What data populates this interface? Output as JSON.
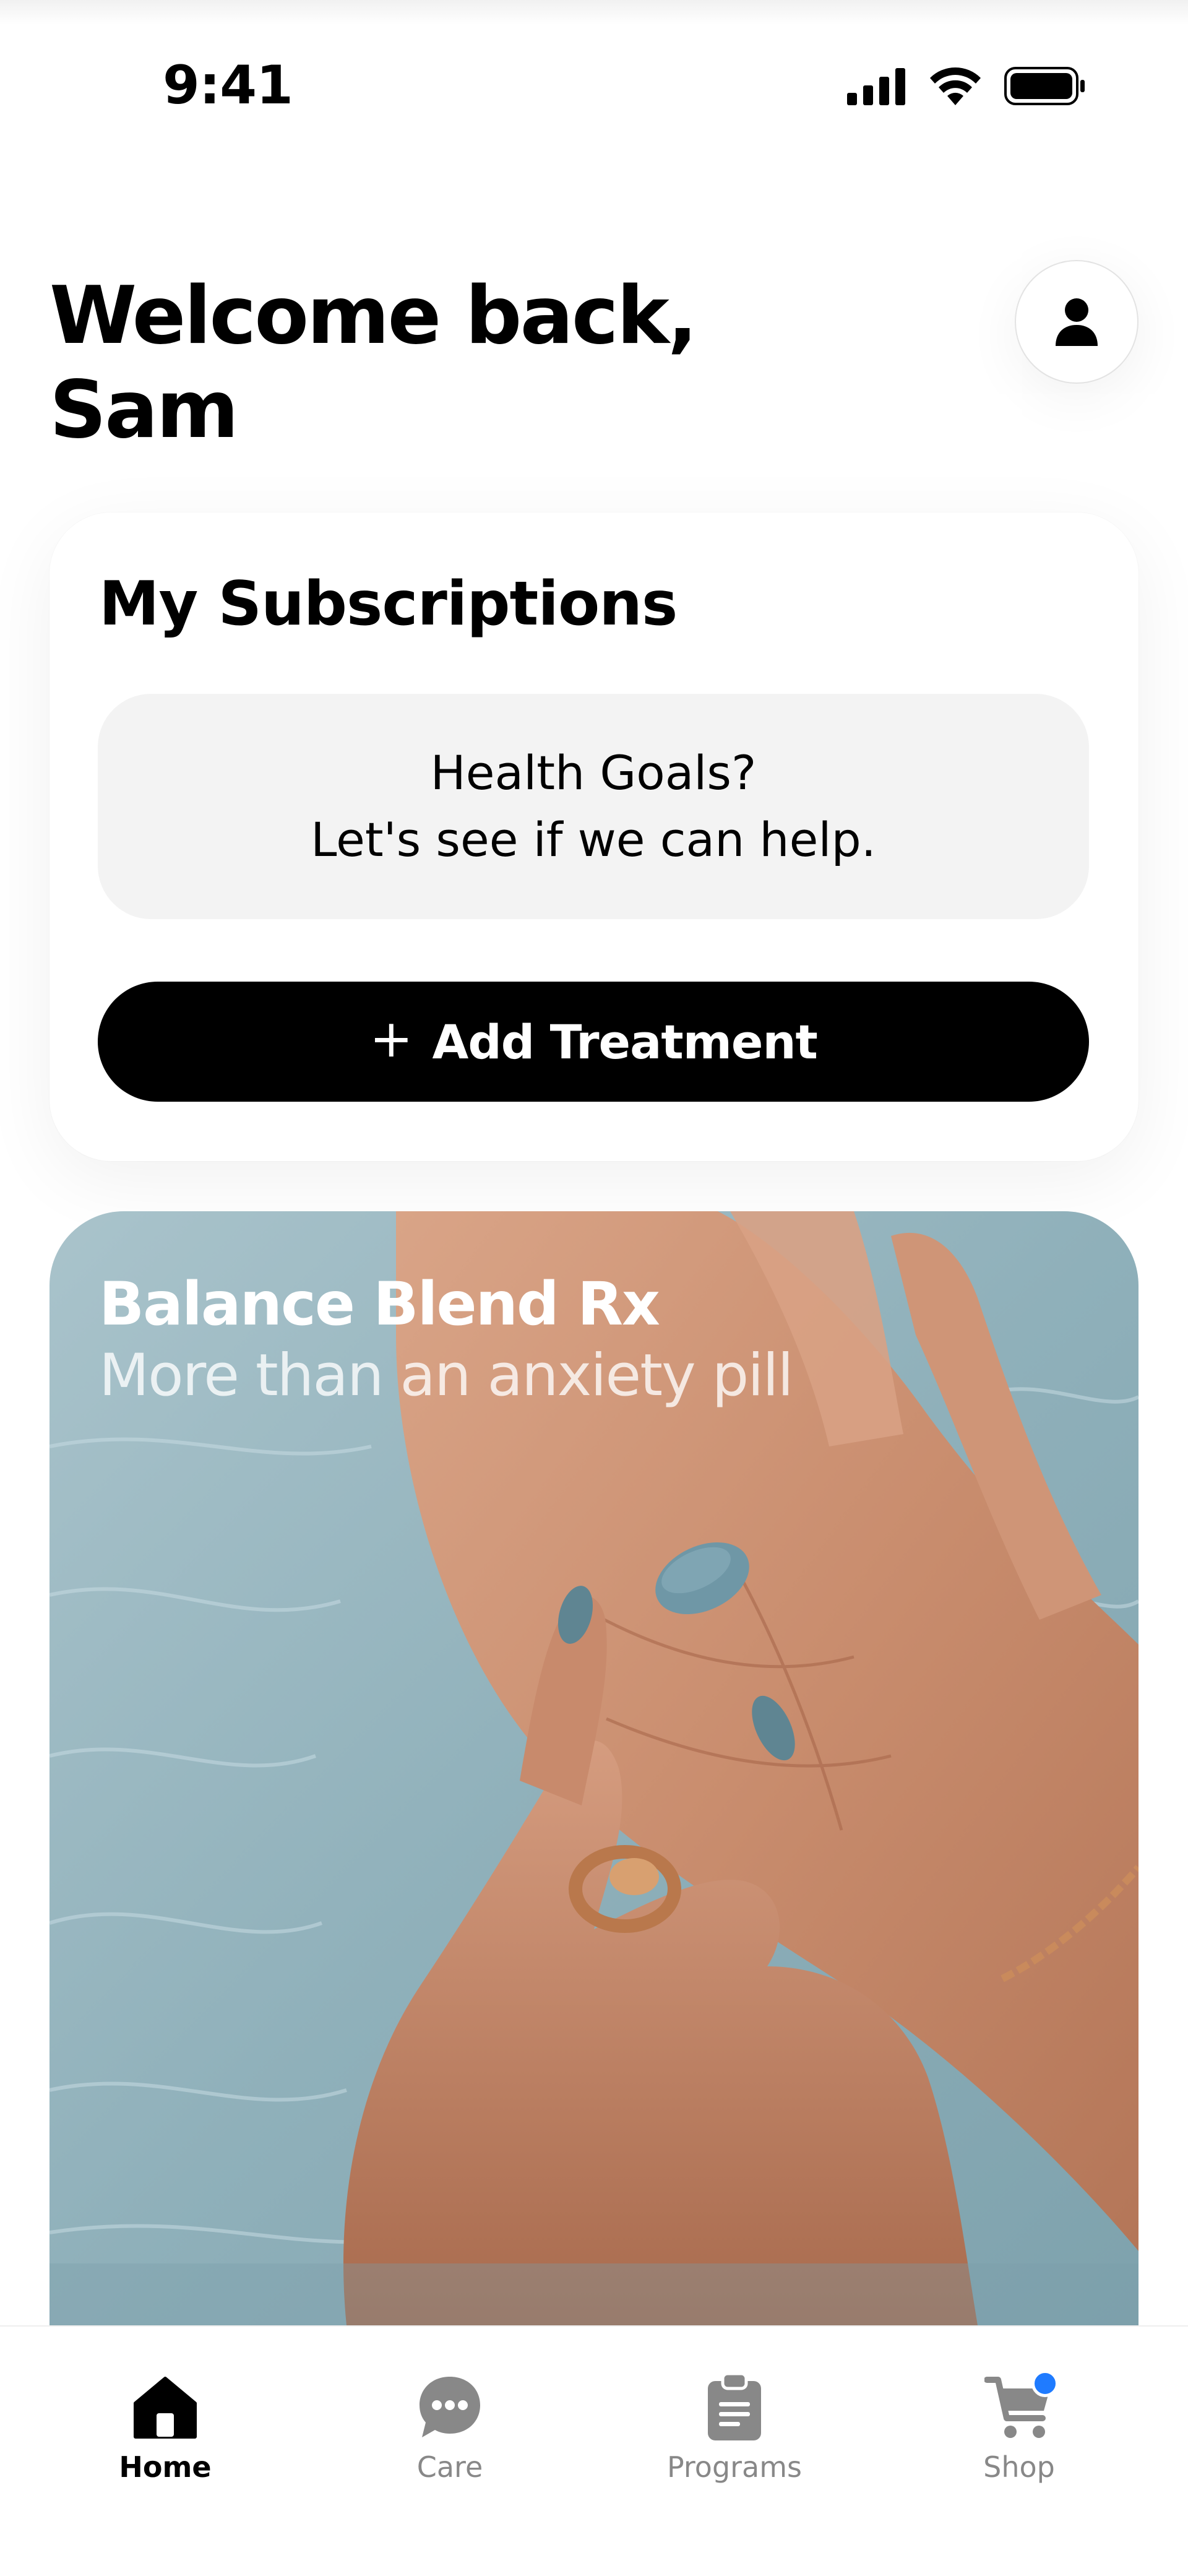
{
  "status_bar": {
    "time": "9:41",
    "icons": [
      "cellular-signal-icon",
      "wifi-icon",
      "battery-icon"
    ]
  },
  "header": {
    "greeting_line1": "Welcome back,",
    "greeting_line2": "Sam",
    "profile_icon": "person-icon"
  },
  "subscriptions": {
    "title": "My Subscriptions",
    "empty_line1": "Health Goals?",
    "empty_line2": "Let's see if we can help.",
    "add_button_label": "Add Treatment",
    "add_button_icon": "plus-icon"
  },
  "promo": {
    "title": "Balance Blend Rx",
    "subtitle": "More than an anxiety pill",
    "image_description": "hands-holding-blue-pill-over-water"
  },
  "tab_bar": {
    "active": "Home",
    "tabs": [
      {
        "label": "Home",
        "icon": "home-icon"
      },
      {
        "label": "Care",
        "icon": "chat-bubble-icon"
      },
      {
        "label": "Programs",
        "icon": "clipboard-icon"
      },
      {
        "label": "Shop",
        "icon": "cart-icon",
        "badge": true
      }
    ]
  },
  "colors": {
    "accent": "#000000",
    "badge": "#1f7bff",
    "inactive_tab": "#888888",
    "goals_bg": "#f3f3f3"
  }
}
